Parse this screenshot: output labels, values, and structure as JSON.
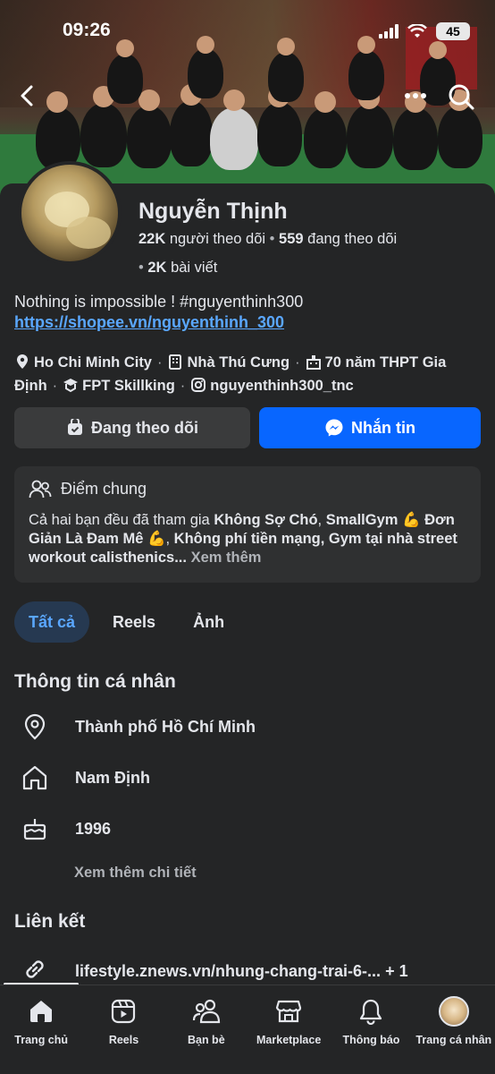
{
  "status_bar": {
    "time": "09:26",
    "battery": "45"
  },
  "profile": {
    "name": "Nguyễn Thịnh",
    "followers_count": "22K",
    "followers_label": "người theo dõi",
    "following_count": "559",
    "following_label": "đang theo dõi",
    "posts_count": "2K",
    "posts_label": "bài viết",
    "bio": "Nothing is impossible ! #nguyenthinh300",
    "link": "https://shopee.vn/nguyenthinh_300"
  },
  "details": {
    "location": "Ho Chi Minh City",
    "work": "Nhà Thú Cưng",
    "school": "70 năm THPT Gia Định",
    "education": "FPT Skillking",
    "instagram": "nguyenthinh300_tnc"
  },
  "actions": {
    "following_label": "Đang theo dõi",
    "message_label": "Nhắn tin"
  },
  "mutual": {
    "title": "Điểm chung",
    "prefix": "Cả hai bạn đều đã tham gia ",
    "group1": "Không Sợ Chó",
    "comma1": ", ",
    "group2": "SmallGym 💪 Đơn Giản Là Đam Mê 💪",
    "comma2": ", ",
    "group3": "Không phí tiền mạng, Gym tại nhà street workout calisthenics...",
    "see_more": "Xem thêm"
  },
  "tabs": [
    {
      "label": "Tất cả",
      "active": true
    },
    {
      "label": "Reels",
      "active": false
    },
    {
      "label": "Ảnh",
      "active": false
    }
  ],
  "personal_info": {
    "title": "Thông tin cá nhân",
    "city": "Thành phố Hồ Chí Minh",
    "hometown": "Nam Định",
    "birth_year": "1996",
    "see_more": "Xem thêm chi tiết"
  },
  "links": {
    "title": "Liên kết",
    "url": "lifestyle.znews.vn/nhung-chang-trai-6-...",
    "extra": "+ 1"
  },
  "bottom_nav": [
    {
      "label": "Trang chủ",
      "icon": "home-icon"
    },
    {
      "label": "Reels",
      "icon": "reels-icon"
    },
    {
      "label": "Bạn bè",
      "icon": "friends-icon"
    },
    {
      "label": "Marketplace",
      "icon": "marketplace-icon"
    },
    {
      "label": "Thông báo",
      "icon": "bell-icon"
    },
    {
      "label": "Trang cá nhân",
      "icon": "profile-avatar"
    }
  ],
  "colors": {
    "accent": "#0866ff",
    "link": "#5aa7ff",
    "background": "#242526",
    "surface": "#3a3b3c"
  }
}
